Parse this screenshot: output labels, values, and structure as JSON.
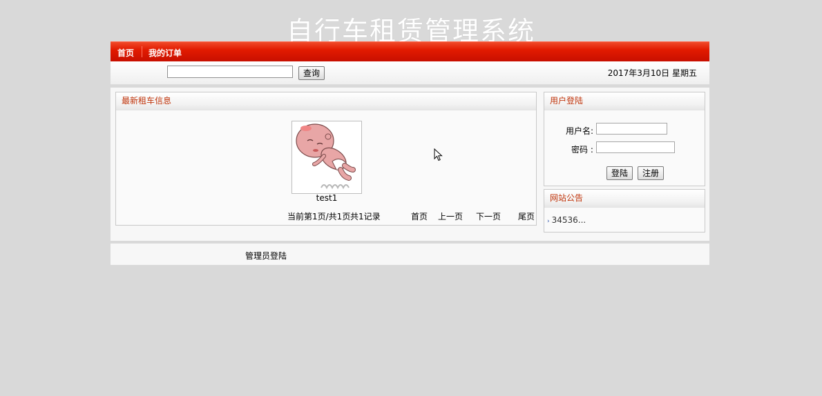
{
  "site": {
    "title": "自行车租赁管理系统"
  },
  "nav": {
    "items": [
      {
        "label": "首页"
      },
      {
        "label": "我的订单"
      }
    ]
  },
  "search": {
    "value": "",
    "placeholder": "",
    "button_label": "查询"
  },
  "date_text": "2017年3月10日 星期五",
  "latest": {
    "title": "最新租车信息",
    "items": [
      {
        "name": "test1",
        "image_icon": "cartoon-baby-image"
      }
    ],
    "pager": {
      "status": "当前第1页/共1页",
      "total": "共1记录",
      "first": "首页",
      "prev": "上一页",
      "next": "下一页",
      "last": "尾页"
    }
  },
  "login": {
    "title": "用户登陆",
    "username_label": "用户名:",
    "password_label": "密码 :",
    "username_value": "",
    "password_value": "",
    "login_button": "登陆",
    "register_button": "注册"
  },
  "notice": {
    "title": "网站公告",
    "items": [
      {
        "text": "34536..."
      }
    ]
  },
  "footer": {
    "admin_link": "管理员登陆"
  },
  "colors": {
    "nav_red": "#e21b00",
    "panel_title": "#c0350c",
    "background": "#d9d9d9"
  }
}
